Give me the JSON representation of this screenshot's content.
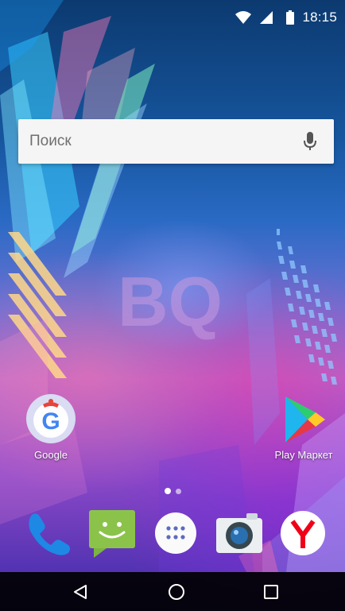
{
  "status_bar": {
    "time": "18:15",
    "icons": [
      "wifi-icon",
      "cellular-signal-icon",
      "battery-icon"
    ]
  },
  "search": {
    "placeholder": "Поиск",
    "mic_icon": "microphone-icon"
  },
  "wallpaper": {
    "logo_text": "BQ"
  },
  "home_apps": [
    {
      "label": "Google",
      "icon": "google-icon"
    },
    {
      "label": "Play Маркет",
      "icon": "play-store-icon"
    }
  ],
  "page_indicator": {
    "pages": 2,
    "current": 1
  },
  "dock": [
    {
      "name": "phone",
      "icon": "phone-icon"
    },
    {
      "name": "messaging",
      "icon": "messaging-icon"
    },
    {
      "name": "app-drawer",
      "icon": "app-drawer-icon"
    },
    {
      "name": "camera",
      "icon": "camera-icon"
    },
    {
      "name": "yandex",
      "icon": "yandex-icon"
    }
  ],
  "nav_bar": {
    "buttons": [
      "back-icon",
      "home-icon",
      "recents-icon"
    ]
  },
  "colors": {
    "search_bg": "#f5f5f5",
    "nav_bg": "#000000",
    "yandex_red": "#f00018",
    "messaging_green": "#8bc34a",
    "phone_blue": "#2196f3"
  }
}
